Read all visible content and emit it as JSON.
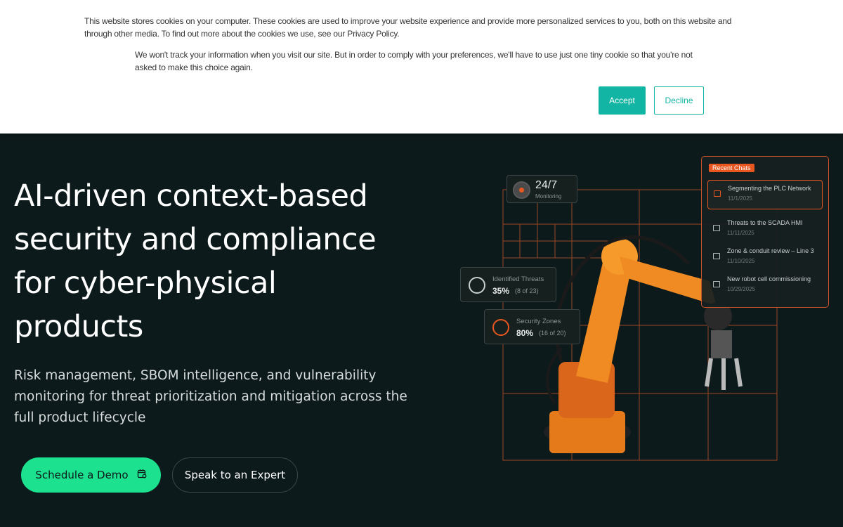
{
  "cookie": {
    "text1": "This website stores cookies on your computer. These cookies are used to improve your website experience and provide more personalized services to you, both on this website and through other media. To find out more about the cookies we use, see our Privacy Policy.",
    "text2": "We won't track your information when you visit our site. But in order to comply with your preferences, we'll have to use just one tiny cookie so that you're not asked to make this choice again.",
    "accept_label": "Accept",
    "decline_label": "Decline"
  },
  "hero": {
    "title": "AI-driven context-based security and compliance for cyber-physical products",
    "subtitle": "Risk management, SBOM intelligence, and vulnerability monitoring for threat prioritization and mitigation across the full product lifecycle",
    "demo_label": "Schedule a Demo",
    "expert_label": "Speak to an Expert"
  },
  "illustration": {
    "monitoring": {
      "value": "24/7",
      "label": "Monitoring"
    },
    "threats": {
      "label": "Identified Threats",
      "value": "35%",
      "detail": "(8 of 23)",
      "fraction": 0.35
    },
    "zones": {
      "label": "Security Zones",
      "value": "80%",
      "detail": "(16 of 20)",
      "fraction": 0.8
    },
    "recent_chats": {
      "tag": "Recent Chats",
      "items": [
        {
          "title": "Segmenting the PLC Network",
          "date": "11/1/2025"
        },
        {
          "title": "Threats to the SCADA HMI",
          "date": "11/11/2025"
        },
        {
          "title": "Zone & conduit review – Line 3",
          "date": "11/10/2025"
        },
        {
          "title": "New robot cell commissioning",
          "date": "10/29/2025"
        }
      ]
    }
  },
  "colors": {
    "background": "#0d1a1b",
    "accent_green": "#1ce18f",
    "accent_teal": "#12b5a3",
    "accent_orange": "#e8571f"
  }
}
